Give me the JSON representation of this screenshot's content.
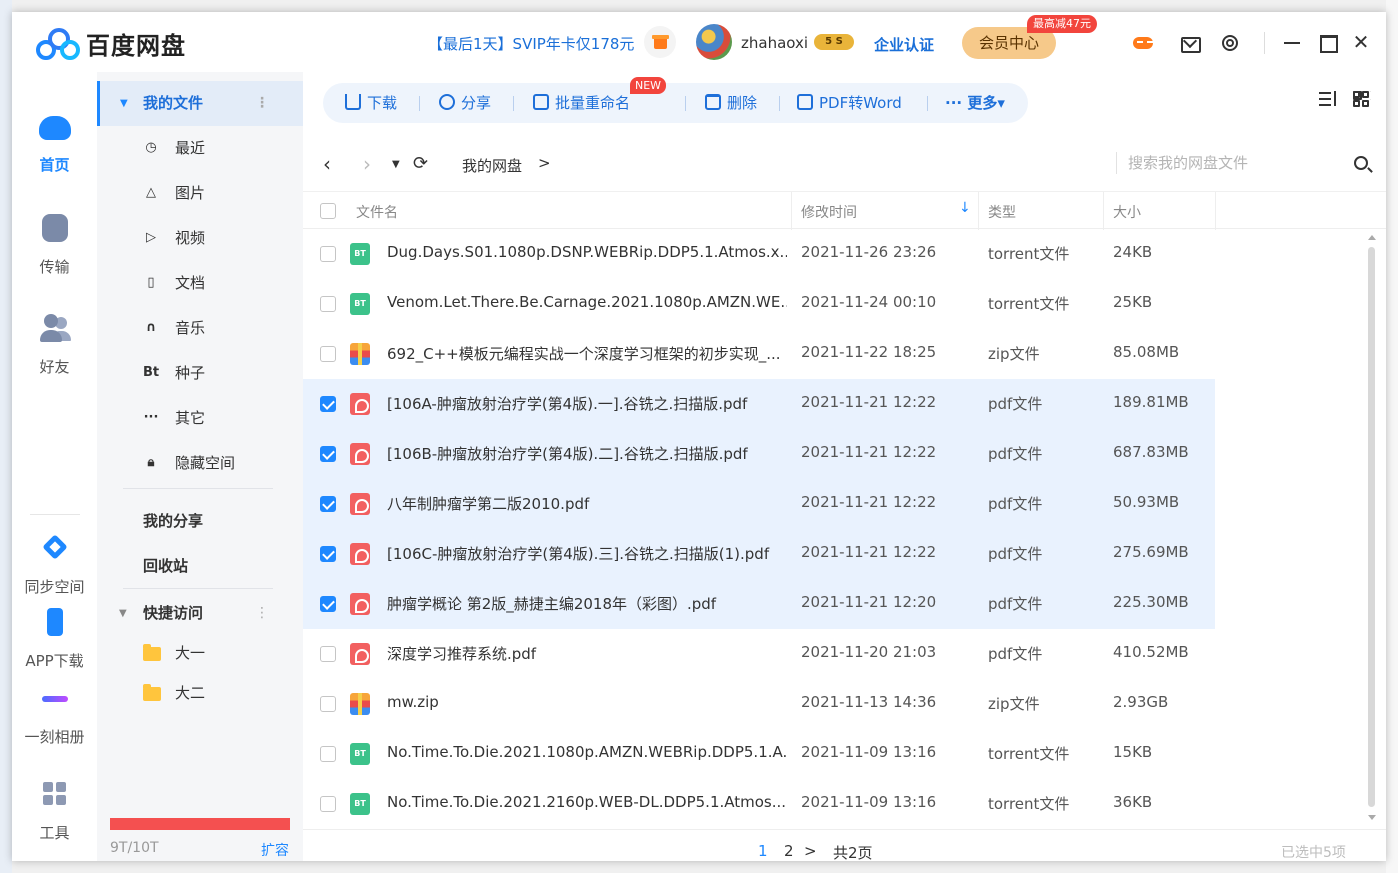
{
  "app": {
    "name": "百度网盘",
    "promo": "【最后1天】SVIP年卡仅178元",
    "username": "zhahaoxi",
    "vip_level": "5",
    "enterprise": "企业认证",
    "member_center": "会员中心",
    "member_tag": "最高减47元"
  },
  "leftnav": {
    "home": "首页",
    "transfer": "传输",
    "friends": "好友",
    "sync": "同步空间",
    "app_download": "APP下载",
    "album": "一刻相册",
    "tools": "工具"
  },
  "sidebar": {
    "my_files": "我的文件",
    "recent": "最近",
    "images": "图片",
    "videos": "视频",
    "docs": "文档",
    "music": "音乐",
    "torrents": "种子",
    "torrents_icon": "Bt",
    "others": "其它",
    "others_icon": "···",
    "hidden": "隐藏空间",
    "my_share": "我的分享",
    "recycle": "回收站",
    "quick_access": "快捷访问",
    "folders": [
      "大一",
      "大二"
    ],
    "storage": "9T/10T",
    "storage_fraction": 0.9,
    "expand": "扩容"
  },
  "toolbar": {
    "download": "下载",
    "share": "分享",
    "batch_rename": "批量重命名",
    "new_tag": "NEW",
    "delete": "删除",
    "pdf_to_word": "PDF转Word",
    "more": "··· 更多▾"
  },
  "path": {
    "root": "我的网盘",
    "chevron": ">",
    "search_placeholder": "搜索我的网盘文件"
  },
  "table": {
    "headers": {
      "name": "文件名",
      "time": "修改时间",
      "type": "类型",
      "size": "大小"
    },
    "rows": [
      {
        "name": "Dug.Days.S01.1080p.DSNP.WEBRip.DDP5.1.Atmos.x...",
        "time": "2021-11-26 23:26",
        "type": "torrent文件",
        "size": "24KB",
        "icon": "bt",
        "selected": false
      },
      {
        "name": "Venom.Let.There.Be.Carnage.2021.1080p.AMZN.WE...",
        "time": "2021-11-24 00:10",
        "type": "torrent文件",
        "size": "25KB",
        "icon": "bt",
        "selected": false
      },
      {
        "name": "692_C++模板元编程实战一个深度学习框架的初步实现_...",
        "time": "2021-11-22 18:25",
        "type": "zip文件",
        "size": "85.08MB",
        "icon": "zip",
        "selected": false
      },
      {
        "name": "[106A-肿瘤放射治疗学(第4版).一].谷铣之.扫描版.pdf",
        "time": "2021-11-21 12:22",
        "type": "pdf文件",
        "size": "189.81MB",
        "icon": "pdf",
        "selected": true
      },
      {
        "name": "[106B-肿瘤放射治疗学(第4版).二].谷铣之.扫描版.pdf",
        "time": "2021-11-21 12:22",
        "type": "pdf文件",
        "size": "687.83MB",
        "icon": "pdf",
        "selected": true
      },
      {
        "name": "八年制肿瘤学第二版2010.pdf",
        "time": "2021-11-21 12:22",
        "type": "pdf文件",
        "size": "50.93MB",
        "icon": "pdf",
        "selected": true
      },
      {
        "name": "[106C-肿瘤放射治疗学(第4版).三].谷铣之.扫描版(1).pdf",
        "time": "2021-11-21 12:22",
        "type": "pdf文件",
        "size": "275.69MB",
        "icon": "pdf",
        "selected": true
      },
      {
        "name": "肿瘤学概论 第2版_赫捷主编2018年（彩图）.pdf",
        "time": "2021-11-21 12:20",
        "type": "pdf文件",
        "size": "225.30MB",
        "icon": "pdf",
        "selected": true
      },
      {
        "name": "深度学习推荐系统.pdf",
        "time": "2021-11-20 21:03",
        "type": "pdf文件",
        "size": "410.52MB",
        "icon": "pdf",
        "selected": false
      },
      {
        "name": "mw.zip",
        "time": "2021-11-13 14:36",
        "type": "zip文件",
        "size": "2.93GB",
        "icon": "zip",
        "selected": false
      },
      {
        "name": "No.Time.To.Die.2021.1080p.AMZN.WEBRip.DDP5.1.A...",
        "time": "2021-11-09 13:16",
        "type": "torrent文件",
        "size": "15KB",
        "icon": "bt",
        "selected": false
      },
      {
        "name": "No.Time.To.Die.2021.2160p.WEB-DL.DDP5.1.Atmos....",
        "time": "2021-11-09 13:16",
        "type": "torrent文件",
        "size": "36KB",
        "icon": "bt",
        "selected": false
      }
    ]
  },
  "pagination": {
    "page1": "1",
    "page2": "2",
    "next": ">",
    "total": "共2页",
    "watermark": "已选中5项"
  },
  "colors": {
    "accent": "#1e88ff",
    "selected_row": "#e9f2fe",
    "storage_bar": "#f45050"
  }
}
